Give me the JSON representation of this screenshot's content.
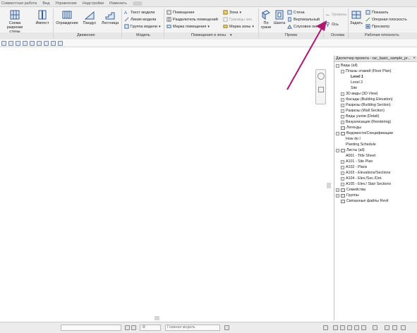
{
  "tabs": [
    "Совместная работа",
    "Вид",
    "Управление",
    "Надстройки",
    "Изменить"
  ],
  "ribbon": {
    "wall_schedule": "Схема разрезки стены",
    "curtain_grid": "Импост",
    "railing": "Ограждение",
    "ramp": "Пандус",
    "stair": "Лестница",
    "model_text": "Текст модели",
    "model_line": "Линия модели",
    "model_group": "Группа модели",
    "room": "Помещение",
    "room_separator": "Разделитель помещений",
    "room_tag": "Марка помещения",
    "area": "Зона",
    "area_boundary": "Границы зон",
    "area_tag": "Марка зоны",
    "by_face": "По грани",
    "shaft": "Шахта",
    "wall_opening": "Стена",
    "vertical": "Вертикальный",
    "dormer": "Слуховое окно",
    "level": "Уровень",
    "grid": "Ось",
    "set": "Задать",
    "show": "Показать",
    "ref_plane": "Опорная плоскость",
    "viewer": "Просмотр",
    "panels": {
      "circulation": "Движение",
      "model": "Модель",
      "room_area": "Помещения и зоны",
      "opening": "Проем",
      "datum": "Основа",
      "work_plane": "Рабочая плоскость"
    }
  },
  "browser": {
    "title": "Диспетчер проекта - rac_basic_sample_pr...",
    "close": "×",
    "items": [
      {
        "label": "Виды (all)",
        "toggle": "−",
        "level": 0
      },
      {
        "label": "Планы этажей (Floor Plan)",
        "toggle": "−",
        "level": 1
      },
      {
        "label": "Level 1",
        "level": 2,
        "bold": true
      },
      {
        "label": "Level 2",
        "level": 2
      },
      {
        "label": "Site",
        "level": 2
      },
      {
        "label": "3D виды (3D View)",
        "toggle": "+",
        "level": 1
      },
      {
        "label": "Фасады (Building Elevation)",
        "toggle": "+",
        "level": 1
      },
      {
        "label": "Разрезы (Building Section)",
        "toggle": "+",
        "level": 1
      },
      {
        "label": "Разрезы (Wall Section)",
        "toggle": "+",
        "level": 1
      },
      {
        "label": "Виды узлов (Detail)",
        "toggle": "+",
        "level": 1
      },
      {
        "label": "Визуализация (Rendering)",
        "toggle": "+",
        "level": 1
      },
      {
        "label": "Легенды",
        "level": 0,
        "icon": true
      },
      {
        "label": "Ведомости/Спецификации",
        "toggle": "−",
        "level": 0,
        "icon": true
      },
      {
        "label": "How do I",
        "level": 1
      },
      {
        "label": "Planting Schedule",
        "level": 1
      },
      {
        "label": "Листы (all)",
        "toggle": "−",
        "level": 0,
        "icon": true
      },
      {
        "label": "A001 - Title Sheet",
        "level": 1
      },
      {
        "label": "A101 - Site Plan",
        "toggle": "+",
        "level": 1
      },
      {
        "label": "A102 - Plans",
        "toggle": "+",
        "level": 1
      },
      {
        "label": "A103 - Elevations/Sections",
        "toggle": "+",
        "level": 1
      },
      {
        "label": "A104 - Elev./Sec./Det.",
        "toggle": "+",
        "level": 1
      },
      {
        "label": "A105 - Elev./ Stair Sections",
        "toggle": "+",
        "level": 1
      },
      {
        "label": "Семейства",
        "toggle": "+",
        "level": 0,
        "icon": true
      },
      {
        "label": "Группы",
        "toggle": "+",
        "level": 0,
        "icon": true
      },
      {
        "label": "Связанные файлы Revit",
        "level": 0,
        "icon": true
      }
    ]
  },
  "status": {
    "model": "Главная модель",
    "zero": ":0"
  },
  "colors": {
    "arrow": "#b0176f"
  }
}
